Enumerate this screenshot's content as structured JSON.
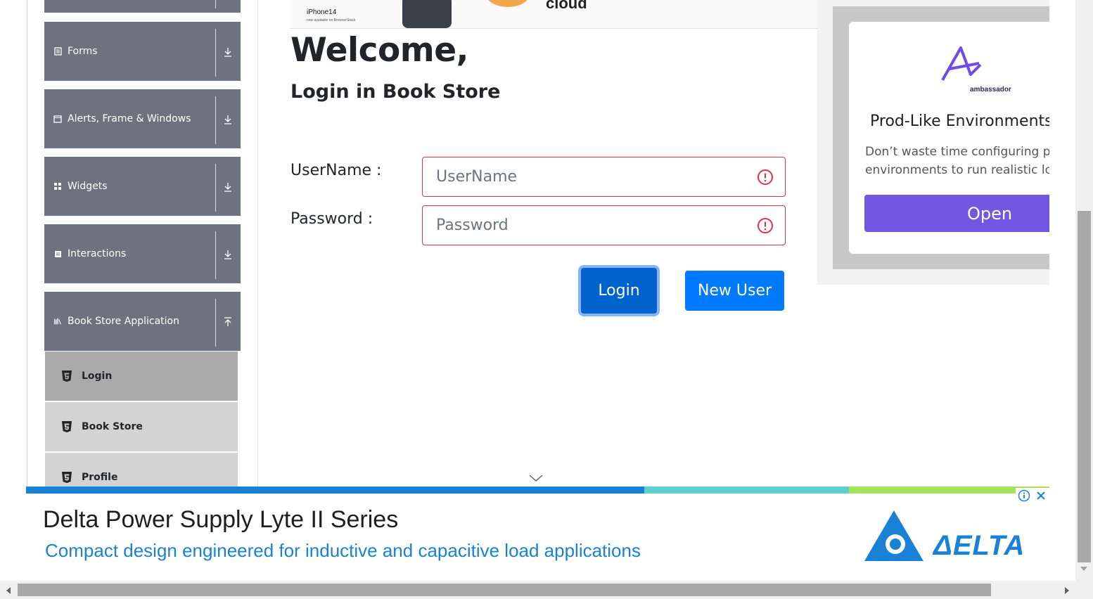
{
  "sidebar": {
    "groups": [
      {
        "label": "Forms",
        "icon": "document-icon",
        "toggle": "expand"
      },
      {
        "label": "Alerts, Frame & Windows",
        "icon": "window-icon",
        "toggle": "expand"
      },
      {
        "label": "Widgets",
        "icon": "grid-icon",
        "toggle": "expand"
      },
      {
        "label": "Interactions",
        "icon": "interactions-icon",
        "toggle": "expand"
      },
      {
        "label": "Book Store Application",
        "icon": "books-icon",
        "toggle": "collapse"
      }
    ],
    "subitems": [
      {
        "label": "Login",
        "active": true
      },
      {
        "label": "Book Store",
        "active": false
      },
      {
        "label": "Profile",
        "active": false
      }
    ]
  },
  "top_ad": {
    "product": "iPhone14",
    "tagline": "now available on BrowserStack",
    "word": "cloud"
  },
  "main": {
    "welcome": "Welcome,",
    "subtitle": "Login in Book Store",
    "username_label": "UserName :",
    "username_placeholder": "UserName",
    "password_label": "Password :",
    "password_placeholder": "Password",
    "login_button": "Login",
    "new_user_button": "New User"
  },
  "right_ad": {
    "brand": "ambassador",
    "headline": "Prod-Like Environments for",
    "body_line1": "Don’t waste time configuring prod",
    "body_line2": "environments to run realistic loca",
    "cta": "Open",
    "accent_color": "#7257e3"
  },
  "bottom_ad": {
    "title": "Delta Power Supply Lyte II Series",
    "subtitle": "Compact design engineered for inductive and capacitive load applications",
    "brand": "ΔELTA",
    "brand_color": "#1a82d6"
  },
  "colors": {
    "sidebar_group": "#6c737e",
    "subitem_active": "#aaaaaa",
    "subitem": "#d3d3d3",
    "primary": "#007bff",
    "invalid": "#dc3545"
  }
}
